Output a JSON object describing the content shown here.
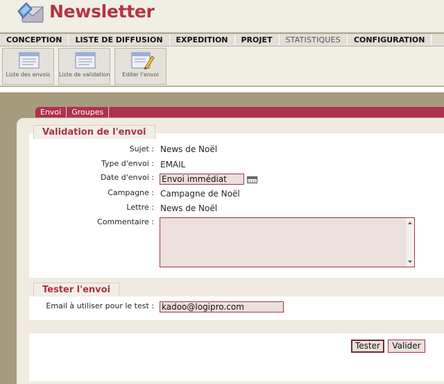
{
  "app": {
    "title": "Newsletter"
  },
  "menu": {
    "items": [
      {
        "label": "CONCEPTION"
      },
      {
        "label": "LISTE DE DIFFUSION"
      },
      {
        "label": "EXPEDITION"
      },
      {
        "label": "PROJET"
      },
      {
        "label": "STATISTIQUES"
      },
      {
        "label": "CONFIGURATION"
      }
    ]
  },
  "toolbar": {
    "buttons": [
      {
        "label": "Liste des envois",
        "icon": "list-window-icon"
      },
      {
        "label": "Liste de validation",
        "icon": "validation-list-icon"
      },
      {
        "label": "Editer l'envoi",
        "icon": "edit-send-icon"
      }
    ]
  },
  "tabs": [
    {
      "label": "Envoi"
    },
    {
      "label": "Groupes"
    }
  ],
  "validation": {
    "title": "Validation de l'envoi",
    "subject_label": "Sujet :",
    "subject_value": "News de Noël",
    "type_label": "Type d'envoi :",
    "type_value": "EMAIL",
    "date_label": "Date d'envoi :",
    "date_value": "Envoi immédiat",
    "campaign_label": "Campagne :",
    "campaign_value": "Campagne de Noël",
    "letter_label": "Lettre :",
    "letter_value": "News de Noël",
    "comment_label": "Commentaire :",
    "comment_value": ""
  },
  "test": {
    "title": "Tester l'envoi",
    "email_label": "Email à utiliser pour le test :",
    "email_value": "kadoo@logipro.com"
  },
  "actions": {
    "test_label": "Tester",
    "validate_label": "Valider"
  },
  "colors": {
    "accent": "#b0304f",
    "title_red": "#b6323f",
    "input_bg": "#ebe0db",
    "page_bg": "#a59c7e"
  }
}
